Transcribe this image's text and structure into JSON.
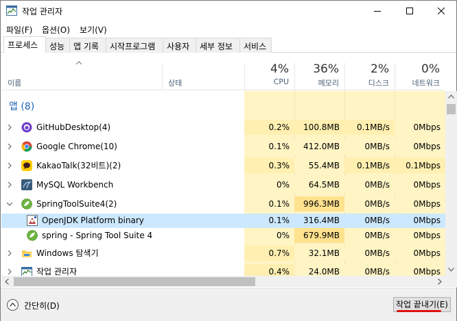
{
  "window": {
    "title": "작업 관리자"
  },
  "menu": [
    "파일(F)",
    "옵션(O)",
    "보기(V)"
  ],
  "tabs": [
    "프로세스",
    "성능",
    "앱 기록",
    "시작프로그램",
    "사용자",
    "세부 정보",
    "서비스"
  ],
  "active_tab": "프로세스",
  "columns": {
    "name": "이름",
    "status": "상태",
    "cpu": {
      "pct": "4%",
      "label": "CPU"
    },
    "memory": {
      "pct": "36%",
      "label": "메모리"
    },
    "disk": {
      "pct": "2%",
      "label": "디스크"
    },
    "network": {
      "pct": "0%",
      "label": "네트워크"
    }
  },
  "group": {
    "label": "앱 (8)"
  },
  "rows": [
    {
      "name": "GitHubDesktop(4)",
      "icon": "github-desktop-icon",
      "expand": "collapsed",
      "cpu": "0.2%",
      "memory": "100.8MB",
      "disk": "0.1MB/s",
      "network": "0Mbps"
    },
    {
      "name": "Google Chrome(10)",
      "icon": "chrome-icon",
      "expand": "collapsed",
      "cpu": "0.1%",
      "memory": "412.0MB",
      "disk": "0MB/s",
      "network": "0Mbps"
    },
    {
      "name": "KakaoTalk(32비트)(2)",
      "icon": "kakaotalk-icon",
      "expand": "collapsed",
      "cpu": "0.3%",
      "memory": "55.4MB",
      "disk": "0.1MB/s",
      "network": "0.1Mbps"
    },
    {
      "name": "MySQL Workbench",
      "icon": "mysql-workbench-icon",
      "expand": "collapsed",
      "cpu": "0%",
      "memory": "64.5MB",
      "disk": "0MB/s",
      "network": "0Mbps"
    },
    {
      "name": "SpringToolSuite4(2)",
      "icon": "spring-tool-suite-icon",
      "expand": "expanded",
      "cpu": "0.1%",
      "memory": "996.3MB",
      "disk": "0MB/s",
      "network": "0Mbps"
    },
    {
      "name": "OpenJDK Platform binary",
      "icon": "openjdk-icon",
      "expand": "child",
      "selected": true,
      "cpu": "0.1%",
      "memory": "316.4MB",
      "disk": "0MB/s",
      "network": "0Mbps"
    },
    {
      "name": "spring - Spring Tool Suite 4",
      "icon": "spring-tool-suite-icon",
      "expand": "child",
      "cpu": "0%",
      "memory": "679.9MB",
      "disk": "0MB/s",
      "network": "0Mbps"
    },
    {
      "name": "Windows 탐색기",
      "icon": "file-explorer-icon",
      "expand": "collapsed",
      "cpu": "0.7%",
      "memory": "32.1MB",
      "disk": "0MB/s",
      "network": "0Mbps"
    },
    {
      "name": "작업 관리자",
      "icon": "task-manager-icon",
      "expand": "collapsed",
      "cpu": "0.4%",
      "memory": "24.0MB",
      "disk": "0MB/s",
      "network": "0Mbps"
    }
  ],
  "footer": {
    "collapse_label": "간단히(D)",
    "end_task_label": "작업 끝내기(E)"
  },
  "colors": {
    "heat_light": "#fff4c4",
    "heat_medium": "#ffefb0",
    "heat_dark": "#ffe18e",
    "selected_row": "#cce8ff",
    "accent_red": "#e01010"
  }
}
